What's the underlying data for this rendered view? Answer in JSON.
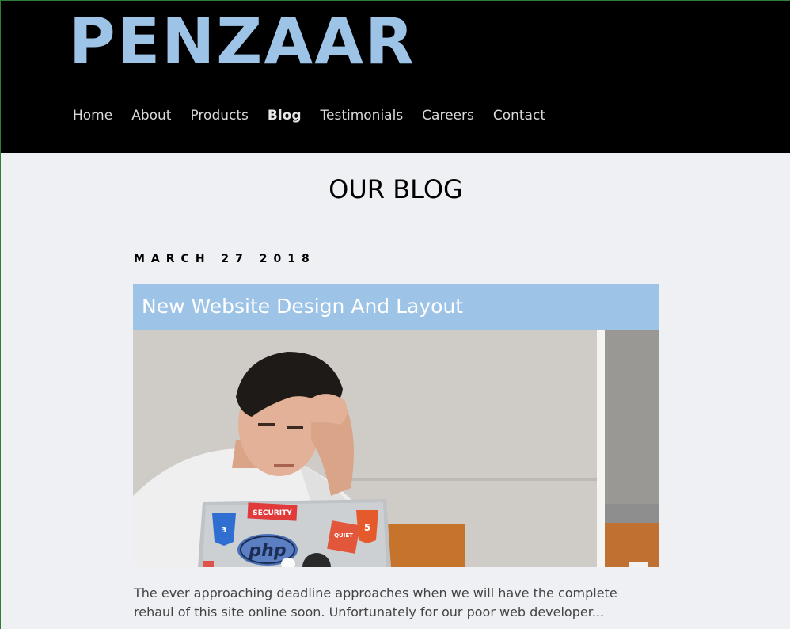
{
  "site": {
    "logo": "PENZAAR",
    "nav": [
      {
        "label": "Home",
        "active": false
      },
      {
        "label": "About",
        "active": false
      },
      {
        "label": "Products",
        "active": false
      },
      {
        "label": "Blog",
        "active": true
      },
      {
        "label": "Testimonials",
        "active": false
      },
      {
        "label": "Careers",
        "active": false
      },
      {
        "label": "Contact",
        "active": false
      }
    ]
  },
  "page": {
    "title": "OUR BLOG"
  },
  "post": {
    "date": "MARCH 27 2018",
    "title": "New Website Design And Layout",
    "image_description": "stressed-developer-at-laptop-photo",
    "stickers": [
      "CSS",
      "SECURITY",
      "QUIET",
      "HTML",
      "php"
    ],
    "excerpt": "The ever approaching deadline approaches when we will have the complete rehaul of this site online soon. Unfortunately for our poor web developer..."
  },
  "colors": {
    "header_bg": "#000000",
    "accent": "#9dc3e6",
    "page_bg": "#eff0f4",
    "nav_text": "#d9d9d9"
  }
}
